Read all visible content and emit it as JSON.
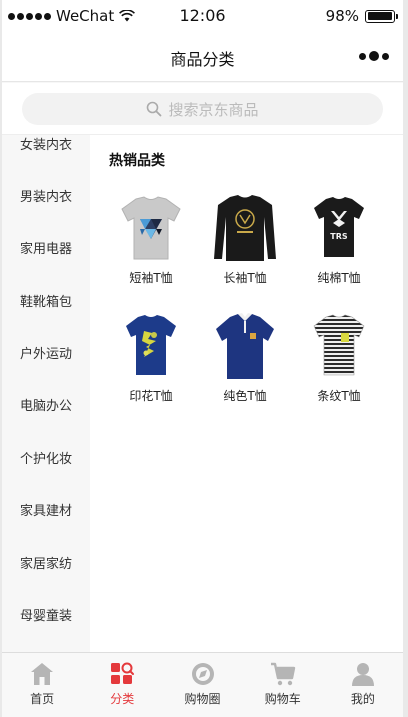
{
  "status_bar": {
    "carrier": "WeChat",
    "time": "12:06",
    "battery": "98%",
    "battery_level": 0.98
  },
  "navbar": {
    "title": "商品分类"
  },
  "search": {
    "placeholder": "搜索京东商品"
  },
  "sidebar": {
    "items": [
      {
        "label": "女装内衣"
      },
      {
        "label": "男装内衣"
      },
      {
        "label": "家用电器"
      },
      {
        "label": "鞋靴箱包"
      },
      {
        "label": "户外运动"
      },
      {
        "label": "电脑办公"
      },
      {
        "label": "个护化妆"
      },
      {
        "label": "家具建材"
      },
      {
        "label": "家居家纺"
      },
      {
        "label": "母婴童装"
      }
    ],
    "active_index": 1
  },
  "content": {
    "section_title": "热销品类",
    "products": [
      {
        "label": "短袖T恤"
      },
      {
        "label": "长袖T恤"
      },
      {
        "label": "纯棉T恤"
      },
      {
        "label": "印花T恤"
      },
      {
        "label": "纯色T恤"
      },
      {
        "label": "条纹T恤"
      }
    ]
  },
  "tabbar": {
    "tabs": [
      {
        "label": "首页",
        "icon": "home-icon"
      },
      {
        "label": "分类",
        "icon": "category-icon"
      },
      {
        "label": "购物圈",
        "icon": "discover-icon"
      },
      {
        "label": "购物车",
        "icon": "cart-icon"
      },
      {
        "label": "我的",
        "icon": "user-icon"
      }
    ],
    "active_index": 1
  },
  "colors": {
    "accent": "#e4393c",
    "tab_icon_inactive": "#b5b5b5"
  }
}
